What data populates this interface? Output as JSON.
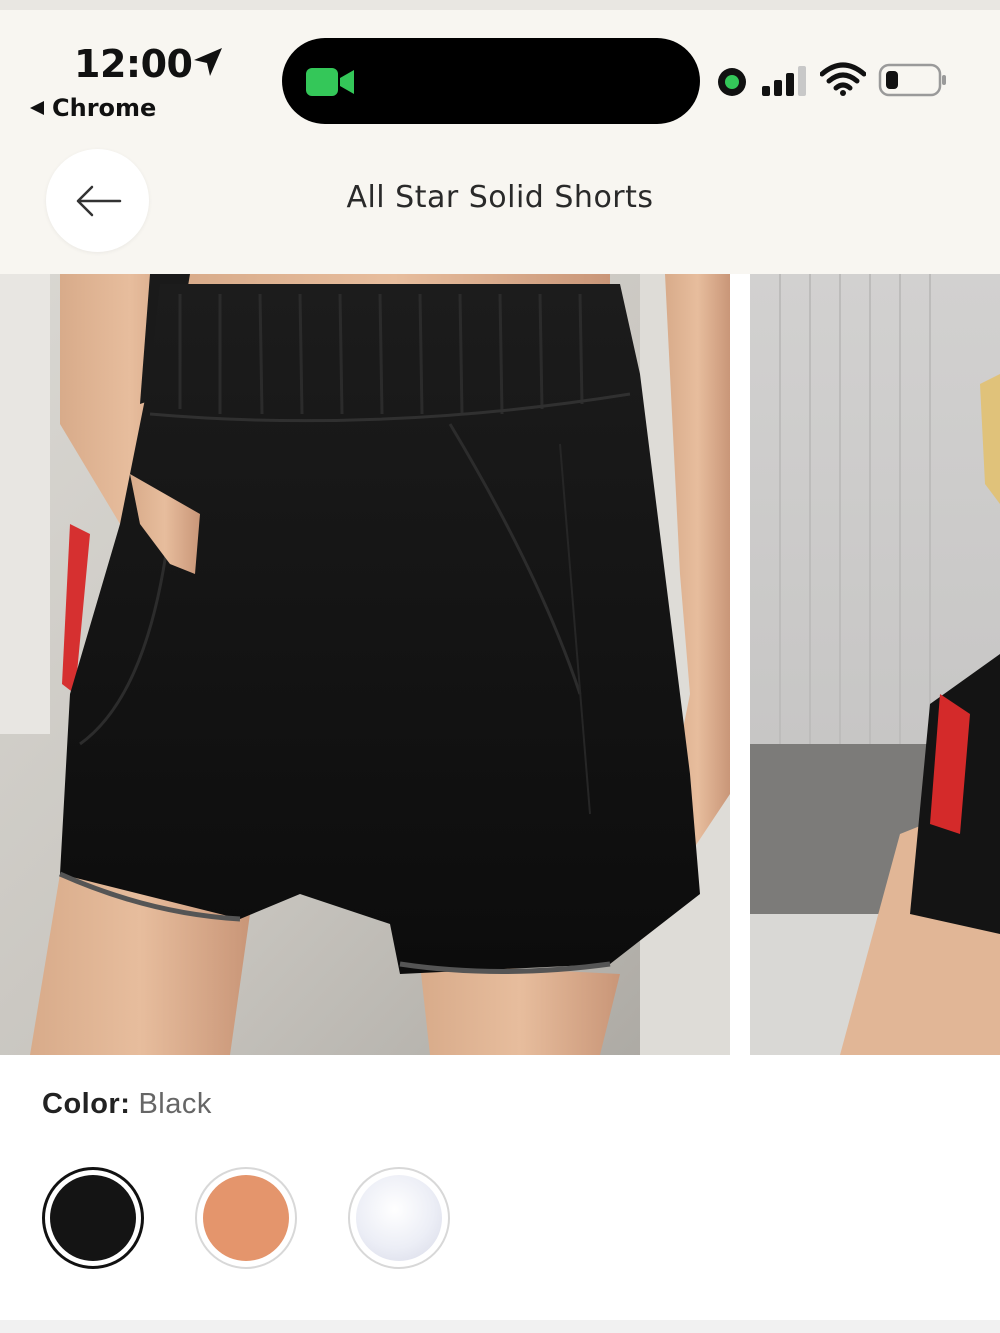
{
  "status_bar": {
    "time": "12:00",
    "back_to_app": "Chrome",
    "facetime_color": "#34c759"
  },
  "header": {
    "title": "All Star Solid Shorts",
    "back_icon": "arrow-left-icon"
  },
  "gallery": {
    "images": [
      {
        "alt": "Black shorts front view"
      },
      {
        "alt": "Black shorts side view"
      }
    ]
  },
  "color_selector": {
    "label": "Color:",
    "selected": "Black",
    "swatches": [
      {
        "name": "Black",
        "color": "#141414"
      },
      {
        "name": "Orange",
        "color": "#e4956c"
      },
      {
        "name": "White",
        "color": "#f4f5fa"
      }
    ]
  }
}
